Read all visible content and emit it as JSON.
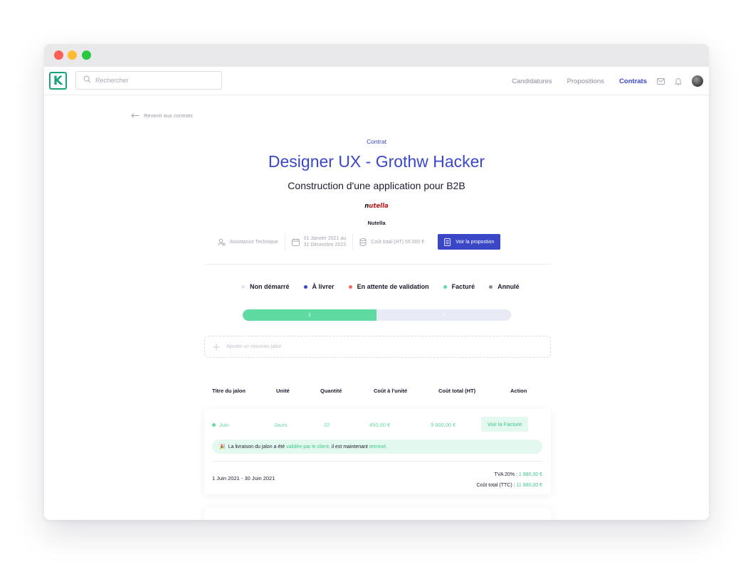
{
  "window": {
    "traffic_lights": [
      "close",
      "minimize",
      "maximize"
    ]
  },
  "header": {
    "logo_letter": "K",
    "search": {
      "placeholder": "Rechercher"
    },
    "nav": [
      {
        "label": "Candidatures",
        "active": false
      },
      {
        "label": "Propositions",
        "active": false
      },
      {
        "label": "Contrats",
        "active": true
      }
    ],
    "icons": [
      "mail-icon",
      "bell-icon",
      "avatar"
    ]
  },
  "page": {
    "back_label": "Revenir aux contrats",
    "eyebrow": "Contrat",
    "title": "Designer UX - Grothw Hacker",
    "subtitle": "Construction d'une application pour B2B",
    "company": {
      "logo_text_n": "n",
      "logo_text_rest": "utella",
      "name": "Nutella"
    },
    "meta": {
      "type": "Assistance Technique",
      "date_line1": "01 Janvier 2021 au",
      "date_line2": "31 Décembre 2022",
      "cost": "Coût total (HT) 55 000 €",
      "proposal_button": "Voir la propostion"
    },
    "legend": [
      {
        "label": "Non démarré",
        "color": "#e4e4ec"
      },
      {
        "label": "À livrer",
        "color": "#3a47c7"
      },
      {
        "label": "En attente de validation",
        "color": "#f06b6b"
      },
      {
        "label": "Facturé",
        "color": "#5fdba1"
      },
      {
        "label": "Annulé",
        "color": "#8a8a96"
      }
    ],
    "progress": {
      "segments": [
        "1",
        "2"
      ],
      "completed": 1,
      "total": 2
    },
    "add_milestone": "Ajouter un nouveau jalon",
    "table": {
      "headers": [
        "Titre du jalon",
        "Unité",
        "Quantité",
        "Coût à l'unité",
        "Coût total (HT)",
        "Action"
      ],
      "rows": [
        {
          "title": "Juin",
          "unit": "Jours",
          "quantity": "22",
          "unit_cost": "450,00 €",
          "total_ht": "9 900,00 €",
          "action": "Voir la Facture",
          "notice_emoji": "🎉",
          "notice_part1": "La livraison du jalon a été",
          "notice_hl1": "validée par le client,",
          "notice_part2": "il est maintenant",
          "notice_hl2": "terminé.",
          "date_range": "1 Juin 2021 - 30 Juin 2021",
          "tva_label": "TVA 20% :",
          "tva_value": "1 980,00 €",
          "ttc_label": "Coût total (TTC) :",
          "ttc_value": "11 880,00 €"
        }
      ]
    }
  },
  "colors": {
    "accent": "#3a47c7",
    "success": "#5fdba1",
    "brand_logo": "#1aa37a"
  }
}
